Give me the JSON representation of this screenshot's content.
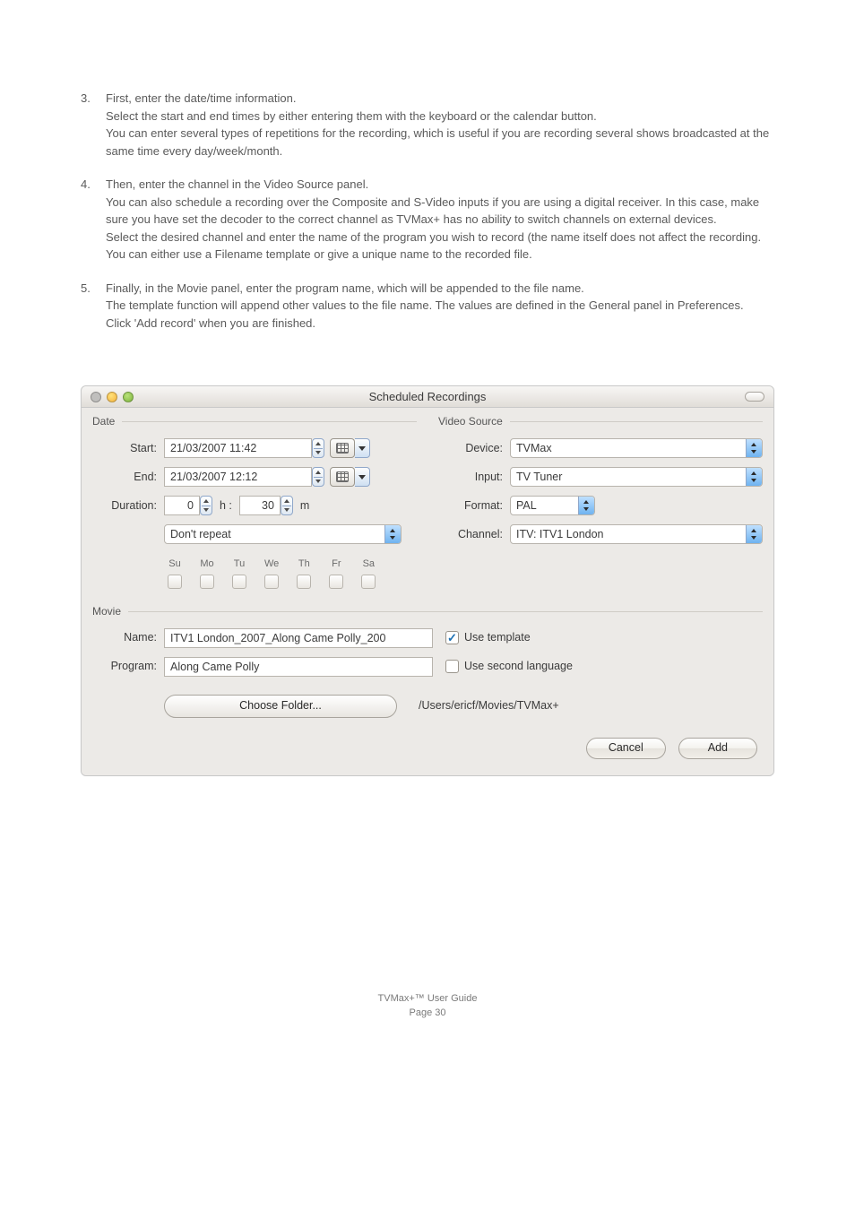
{
  "instructions": [
    {
      "n": "3.",
      "text": "First, enter the date/time information.\nSelect the start and end times by either entering them with the keyboard or the calendar button.\nYou can enter several types of repetitions for the recording, which is useful if you are recording several shows broadcasted at the same time every day/week/month."
    },
    {
      "n": "4.",
      "text": "Then, enter the channel in the Video Source panel.\nYou can also schedule a recording over the Composite and S-Video inputs if you are using a digital receiver. In this case, make sure you have set the decoder to the correct channel as TVMax+ has no ability to switch channels on external devices.\nSelect the desired channel and enter the name of the program you wish to record (the name itself does not affect the recording. You can either use a Filename template or give a unique name to the recorded file."
    },
    {
      "n": "5.",
      "text": "Finally, in the Movie panel, enter the program name, which will be appended to the file name.\nThe template function will append other values to the file name. The values are defined in the General panel in Preferences.\nClick 'Add record' when you are finished."
    }
  ],
  "window": {
    "title": "Scheduled Recordings",
    "date": {
      "section": "Date",
      "start_label": "Start:",
      "start_value": "21/03/2007 11:42",
      "end_label": "End:",
      "end_value": "21/03/2007 12:12",
      "duration_label": "Duration:",
      "duration_h": "0",
      "h_suffix": "h :",
      "duration_m": "30",
      "m_suffix": "m",
      "repeat_value": "Don't repeat",
      "days": [
        "Su",
        "Mo",
        "Tu",
        "We",
        "Th",
        "Fr",
        "Sa"
      ]
    },
    "source": {
      "section": "Video Source",
      "device_label": "Device:",
      "device_value": "TVMax",
      "input_label": "Input:",
      "input_value": "TV Tuner",
      "format_label": "Format:",
      "format_value": "PAL",
      "channel_label": "Channel:",
      "channel_value": "ITV: ITV1 London"
    },
    "movie": {
      "section": "Movie",
      "name_label": "Name:",
      "name_value": "ITV1 London_2007_Along Came Polly_200",
      "use_template_label": "Use template",
      "program_label": "Program:",
      "program_value": "Along Came Polly",
      "second_lang_label": "Use second language",
      "choose_folder": "Choose Folder...",
      "folder_path": "/Users/ericf/Movies/TVMax+"
    },
    "buttons": {
      "cancel": "Cancel",
      "add": "Add"
    }
  },
  "footer": {
    "line1": "TVMax+™ User Guide",
    "line2": "Page 30"
  }
}
